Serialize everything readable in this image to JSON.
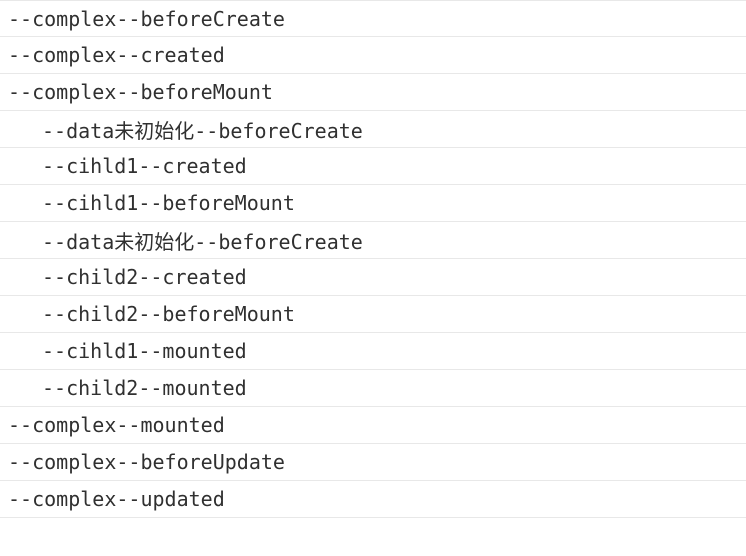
{
  "logs": [
    {
      "text": "--complex--beforeCreate",
      "indented": false
    },
    {
      "text": "--complex--created",
      "indented": false
    },
    {
      "text": "--complex--beforeMount",
      "indented": false
    },
    {
      "text": "--data未初始化--beforeCreate",
      "indented": true
    },
    {
      "text": "--cihld1--created",
      "indented": true
    },
    {
      "text": "--cihld1--beforeMount",
      "indented": true
    },
    {
      "text": "--data未初始化--beforeCreate",
      "indented": true
    },
    {
      "text": "--child2--created",
      "indented": true
    },
    {
      "text": "--child2--beforeMount",
      "indented": true
    },
    {
      "text": "--cihld1--mounted",
      "indented": true
    },
    {
      "text": "--child2--mounted",
      "indented": true
    },
    {
      "text": "--complex--mounted",
      "indented": false
    },
    {
      "text": "--complex--beforeUpdate",
      "indented": false
    },
    {
      "text": "--complex--updated",
      "indented": false
    }
  ]
}
